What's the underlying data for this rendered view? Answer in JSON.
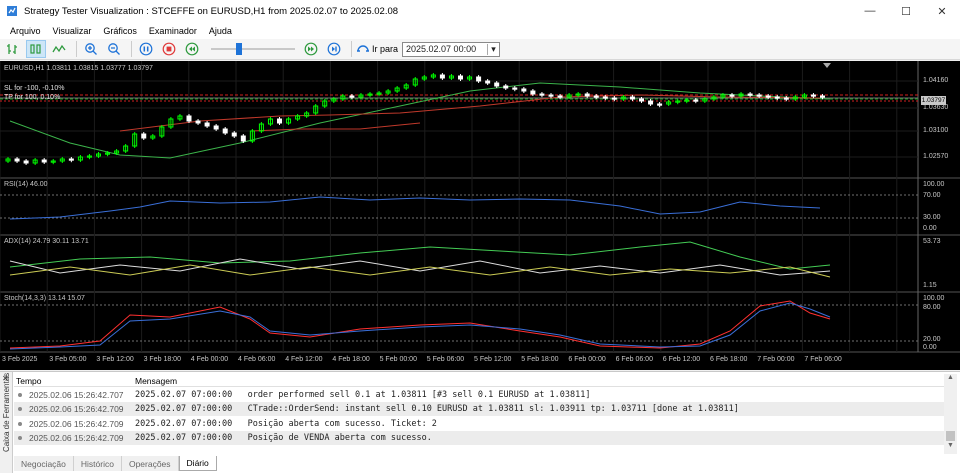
{
  "window": {
    "title": "Strategy Tester Visualization : STCEFFE on EURUSD,H1 from 2025.02.07 to 2025.02.08"
  },
  "menu": [
    "Arquivo",
    "Visualizar",
    "Gráficos",
    "Examinador",
    "Ajuda"
  ],
  "toolbar": {
    "goto_label": "Ir para",
    "date_value": "2025.02.07 00:00"
  },
  "chart": {
    "main_header": "EURUSD,H1  1.03811 1.03815 1.03777 1.03797",
    "sl_label": "SL for -100, -0.10%",
    "tp_label": "TP for 100, 0.10%",
    "current_price": "1.03797",
    "price_ticks": [
      "1.04160",
      "1.03630",
      "1.03100",
      "1.02570"
    ],
    "rsi_header": "RSI(14) 46.00",
    "rsi_ticks": [
      "100.00",
      "70.00",
      "30.00",
      "0.00"
    ],
    "adx_header": "ADX(14) 24.79 30.11 13.71",
    "adx_ticks": [
      "53.73",
      "1.15"
    ],
    "stoch_header": "Stoch(14,3,3) 13.14 15.07",
    "stoch_ticks": [
      "100.00",
      "80.00",
      "20.00",
      "0.00"
    ],
    "time_ticks": [
      "3 Feb 2025",
      "3 Feb 05:00",
      "3 Feb 12:00",
      "3 Feb 18:00",
      "4 Feb 00:00",
      "4 Feb 06:00",
      "4 Feb 12:00",
      "4 Feb 18:00",
      "5 Feb 00:00",
      "5 Feb 06:00",
      "5 Feb 12:00",
      "5 Feb 18:00",
      "6 Feb 00:00",
      "6 Feb 06:00",
      "6 Feb 12:00",
      "6 Feb 18:00",
      "7 Feb 00:00",
      "7 Feb 06:00"
    ],
    "colors": {
      "bull": "#00ff00",
      "bear": "#ffffff",
      "ma_green": "#3cb44b",
      "ma_red": "#c0392b",
      "rsi": "#3a6fd8",
      "stoch_main": "#ff3030",
      "stoch_signal": "#3a6fd8",
      "level": "#707070"
    }
  },
  "toolbox": {
    "side_label": "Caixa de Ferramentas",
    "columns": {
      "time": "Tempo",
      "message": "Mensagem"
    },
    "rows": [
      {
        "time": "2025.02.06 15:26:42.707",
        "message": "2025.02.07 07:00:00   order performed sell 0.1 at 1.03811 [#3 sell 0.1 EURUSD at 1.03811]"
      },
      {
        "time": "2025.02.06 15:26:42.709",
        "message": "2025.02.07 07:00:00   CTrade::OrderSend: instant sell 0.10 EURUSD at 1.03811 sl: 1.03911 tp: 1.03711 [done at 1.03811]"
      },
      {
        "time": "2025.02.06 15:26:42.709",
        "message": "2025.02.07 07:00:00   Posição aberta com sucesso. Ticket: 2"
      },
      {
        "time": "2025.02.06 15:26:42.709",
        "message": "2025.02.07 07:00:00   Posição de VENDA aberta com sucesso."
      }
    ],
    "tabs": [
      "Negociação",
      "Histórico",
      "Operações",
      "Diário"
    ]
  }
}
